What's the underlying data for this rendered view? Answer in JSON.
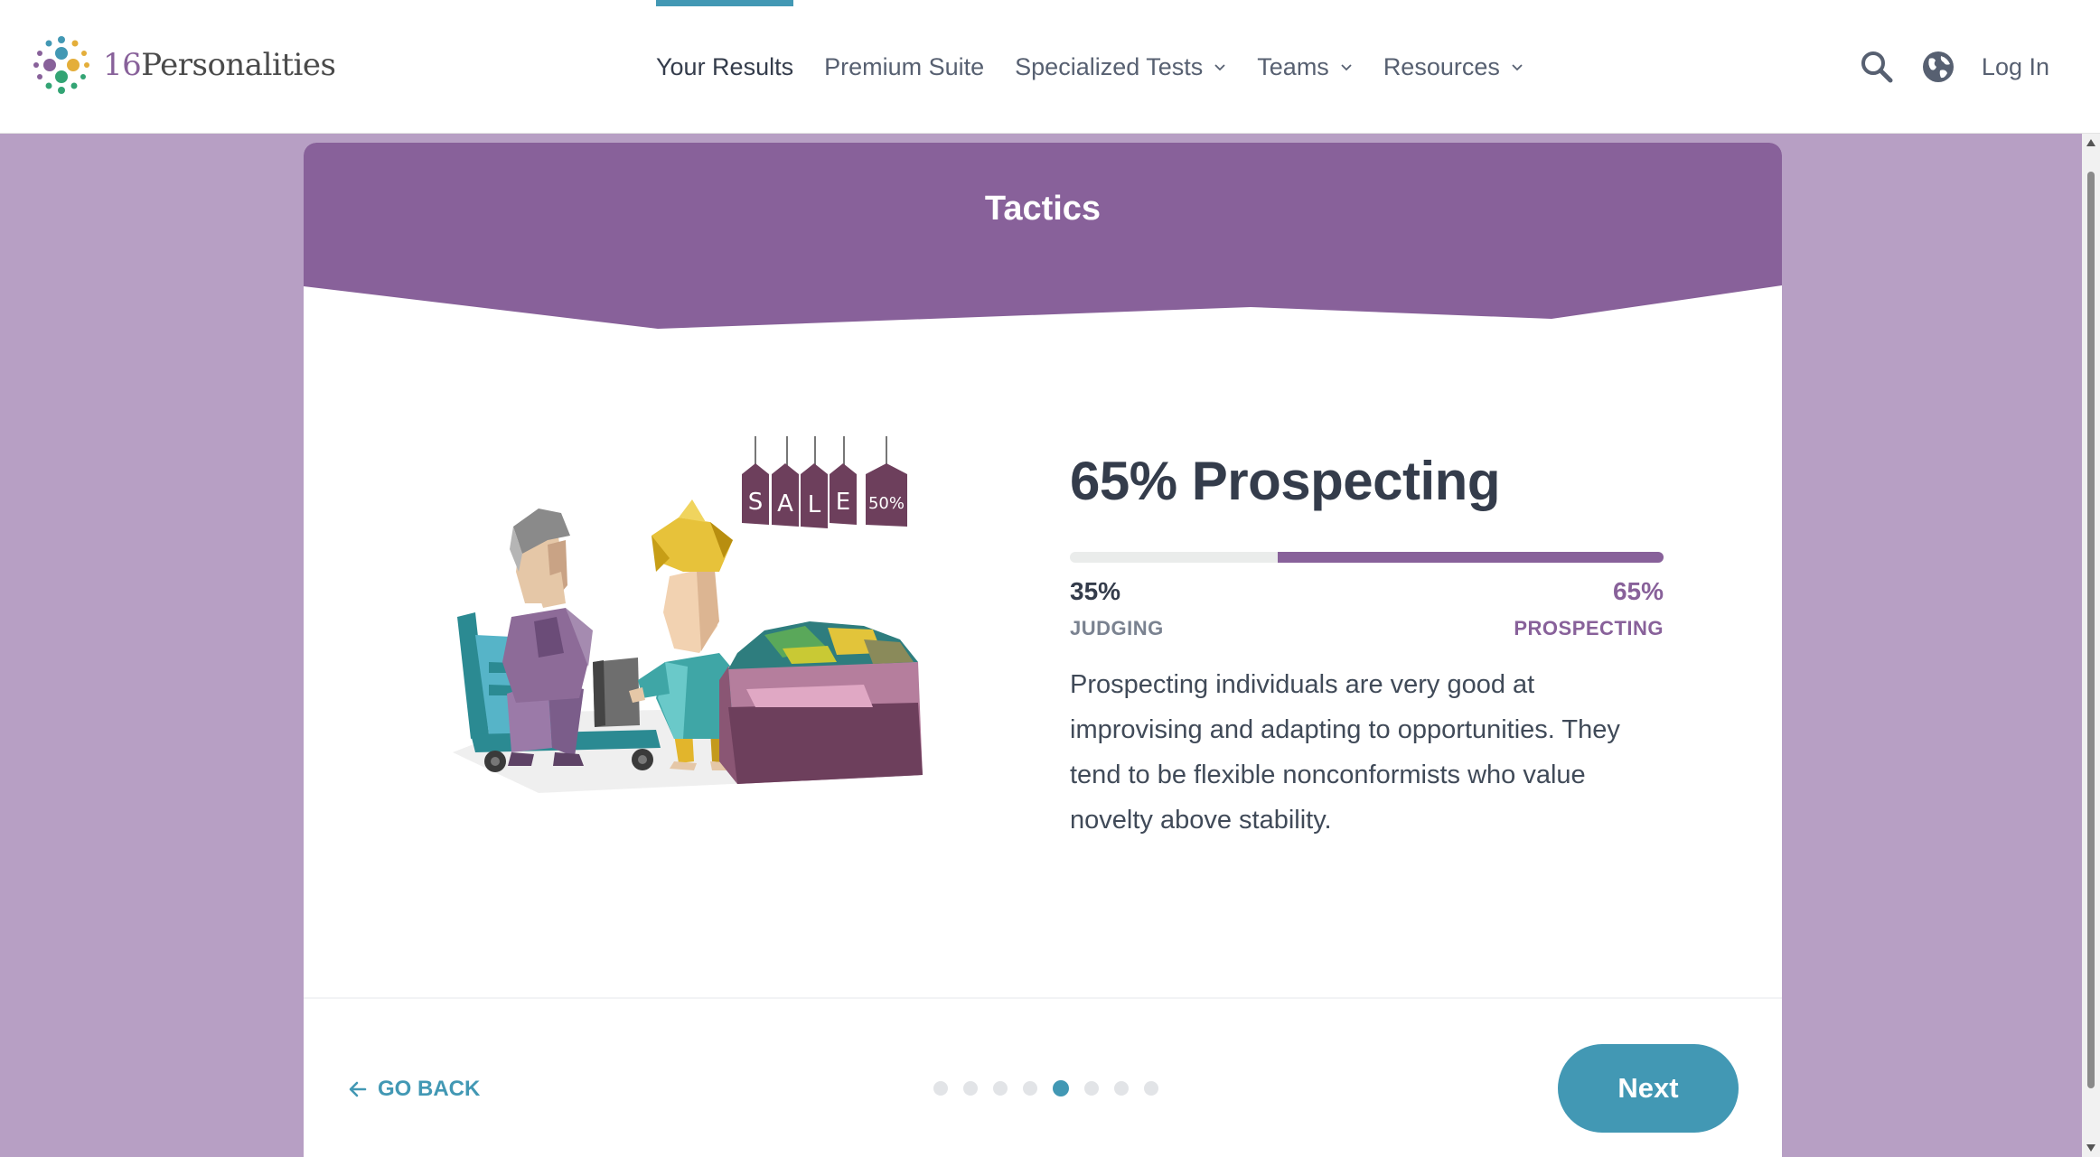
{
  "header": {
    "logo_number": "16",
    "logo_word": "Personalities",
    "nav": [
      {
        "label": "Your Results",
        "dropdown": false,
        "active": true
      },
      {
        "label": "Premium Suite",
        "dropdown": false,
        "active": false
      },
      {
        "label": "Specialized Tests",
        "dropdown": true,
        "active": false
      },
      {
        "label": "Teams",
        "dropdown": true,
        "active": false
      },
      {
        "label": "Resources",
        "dropdown": true,
        "active": false
      }
    ],
    "icons": [
      "search-icon",
      "globe-icon"
    ],
    "login_label": "Log In"
  },
  "card": {
    "title": "Tactics",
    "illustration_sign": {
      "letters": [
        "S",
        "A",
        "L",
        "E"
      ],
      "discount": "50%"
    },
    "result": {
      "percent": 65,
      "heading": "65% Prospecting",
      "left_pct": "35%",
      "left_trait": "JUDGING",
      "right_pct": "65%",
      "right_trait": "PROSPECTING",
      "description": "Prospecting individuals are very good at improvising and adapting to opportunities. They tend to be flexible nonconformists who value novelty above stability."
    },
    "go_back_label": "GO BACK",
    "next_label": "Next",
    "pagination": {
      "total": 8,
      "current": 5
    }
  },
  "colors": {
    "accent_blue": "#4298b4",
    "purple": "#88619a",
    "page_background": "#b79fc4",
    "text_dark": "#343c4b"
  }
}
